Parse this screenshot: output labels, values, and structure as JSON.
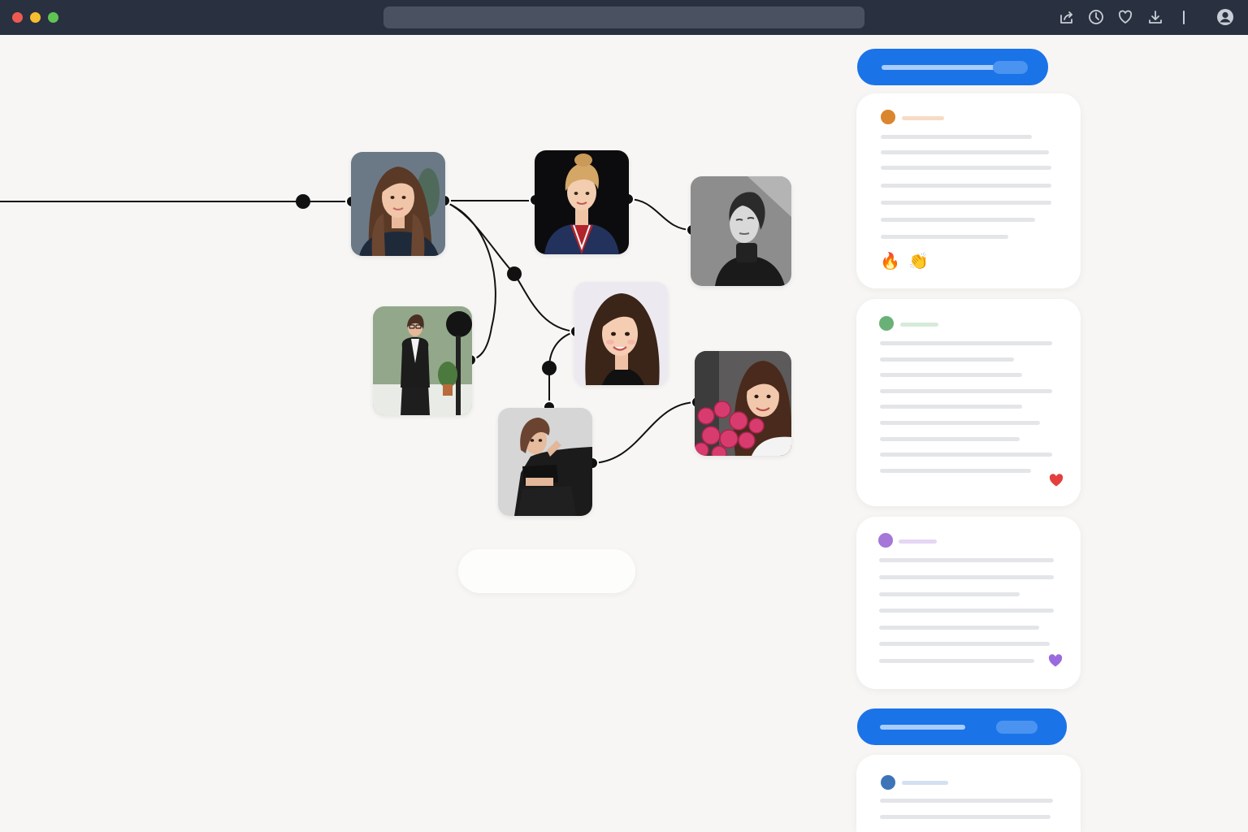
{
  "window": {
    "url": "",
    "toolbar_icons": [
      "share-icon",
      "history-icon",
      "heart-icon",
      "download-icon",
      "account-icon"
    ]
  },
  "graph": {
    "nodes": [
      {
        "id": "portrait-long-hair",
        "icon": "woman-long-hair-portrait"
      },
      {
        "id": "portrait-blonde-lanyard",
        "icon": "woman-blonde-lanyard-portrait"
      },
      {
        "id": "portrait-bw-turtleneck",
        "icon": "woman-turtleneck-bw-portrait"
      },
      {
        "id": "portrait-office-suit",
        "icon": "woman-office-suit-portrait"
      },
      {
        "id": "portrait-smile-dark-hair",
        "icon": "woman-dark-hair-smile-portrait"
      },
      {
        "id": "portrait-roses",
        "icon": "woman-with-roses-portrait"
      },
      {
        "id": "portrait-black-sofa",
        "icon": "woman-black-sofa-portrait"
      }
    ]
  },
  "feed": {
    "accent": "#1b73e8",
    "cards": [
      {
        "avatar_color": "#d9862e",
        "reactions": [
          "🔥",
          "👏"
        ]
      },
      {
        "avatar_color": "#6ab178",
        "reactions": []
      },
      {
        "avatar_color": "#a477d8",
        "reactions": []
      },
      {
        "avatar_color": "#3d74b8",
        "reactions": []
      }
    ]
  }
}
